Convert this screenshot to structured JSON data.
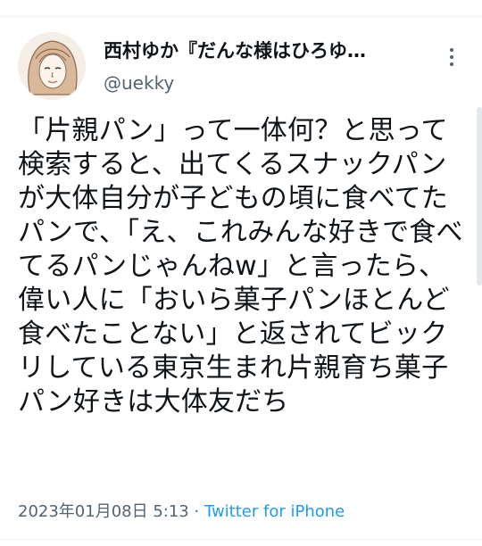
{
  "tweet": {
    "display_name": "西村ゆか『だんな様はひろゆ…",
    "username": "@uekky",
    "avatar_icon": "portrait-avatar",
    "more_icon": "more-vertical-icon",
    "text": "「片親パン」って一体何？と思って検索すると、出てくるスナックパンが大体自分が子どもの頃に食べてたパンで、「え、これみんな好きで食べてるパンじゃんねw」と言ったら、偉い人に「おいら菓子パンほとんど食べたことない」と返されてビックリしている東京生まれ片親育ち菓子パン好きは大体友だち",
    "timestamp": "2023年01月08日 5:13",
    "separator": " · ",
    "source": "Twitter for iPhone"
  },
  "colors": {
    "text": "#0f1419",
    "secondary": "#536471",
    "link": "#1d9bf0",
    "divider": "#eff3f4"
  }
}
